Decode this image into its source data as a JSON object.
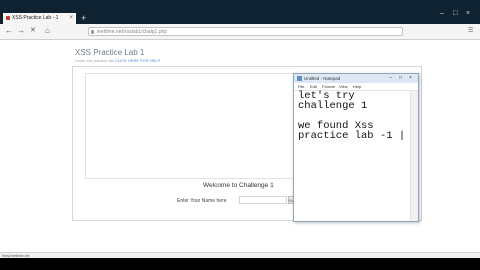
{
  "browser": {
    "tab_title": "XSS Practice Lab - 1",
    "tab_close": "×",
    "new_tab": "+",
    "window_controls": [
      "–",
      "□",
      "×"
    ],
    "back": "←",
    "forward": "→",
    "stop": "✕",
    "home": "⌂",
    "url": "leettime.net/xsslab1/chalg1.php",
    "menu_icon": "☰"
  },
  "page": {
    "title": "XSS Practice Lab 1",
    "subtitle_prefix": "Learn xss practice lab",
    "subtitle_link": "CLICK HERE FOR HELP",
    "welcome": "Welcome to Challenge 1",
    "name_label": "Enter Your Name here",
    "submit": "Sub"
  },
  "notepad": {
    "title": "Untitled - Notepad",
    "menu": [
      "File",
      "Edit",
      "Format",
      "View",
      "Help"
    ],
    "lines": [
      "let's try",
      "challenge 1",
      "",
      "we found Xss",
      "practice lab -1 |"
    ],
    "controls": [
      "–",
      "□",
      "×"
    ]
  },
  "status": "Read leettime.net",
  "icons": {
    "favicon": "favicon-icon",
    "lock": "lock-icon",
    "notepad_app": "notepad-icon"
  }
}
